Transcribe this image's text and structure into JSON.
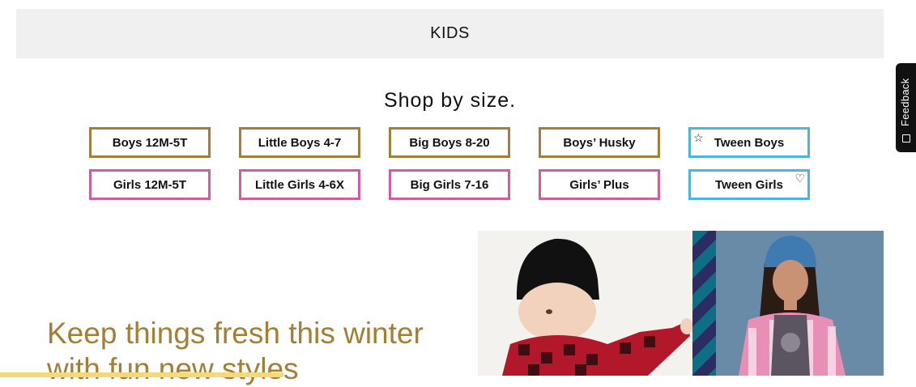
{
  "section": {
    "title": "KIDS"
  },
  "feedback": {
    "label": "Feedback"
  },
  "shop": {
    "title": "Shop by size.",
    "boys": [
      "Boys 12M-5T",
      "Little Boys 4-7",
      "Big Boys 8-20",
      "Boys’ Husky",
      "Tween Boys"
    ],
    "girls": [
      "Girls 12M-5T",
      "Little Girls 4-6X",
      "Big Girls 7-16",
      "Girls’ Plus",
      "Tween Girls"
    ]
  },
  "promo": {
    "headline": "Keep things fresh this winter with fun new styles"
  },
  "colors": {
    "boys_border": "#a47e34",
    "girls_border": "#d85a9e",
    "tween_border": "#4cb4de",
    "headline": "#a47e34",
    "accent_bar": "#f4d97a"
  }
}
